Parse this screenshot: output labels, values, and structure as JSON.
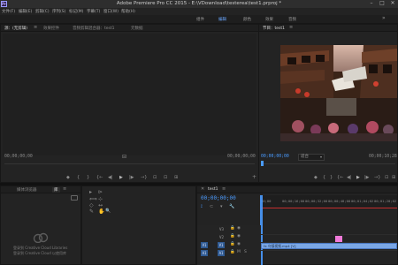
{
  "window": {
    "app_icon": "Pr",
    "title": "Adobe Premiere Pro CC 2015 - E:\\VDownload\\testerea\\test1.prproj *",
    "minimize": "–",
    "maximize": "□",
    "close": "✕"
  },
  "menu": [
    "文件(F)",
    "编辑(E)",
    "剪辑(C)",
    "序列(S)",
    "标记(M)",
    "字幕(T)",
    "窗口(W)",
    "帮助(H)"
  ],
  "workspaces": [
    "组件",
    "编辑",
    "颜色",
    "效果",
    "音频"
  ],
  "workspaces_more": "»",
  "source_panel": {
    "tabs": [
      "源：(无剪辑)",
      "效果控件",
      "音频剪辑混合器：test1",
      "元数据"
    ],
    "menu_icon": "≡",
    "timecode_left": "00;00;00;00",
    "timecode_right": "00;00;00;00",
    "controls": [
      "◆",
      "{",
      "}",
      "{←",
      "◀|",
      "▶",
      "|▶",
      "→}",
      "⊡",
      "⊡",
      "⊞"
    ],
    "add": "+"
  },
  "program_panel": {
    "tab": "节目：test1",
    "menu_icon": "≡",
    "timecode_left": "00;00;00;00",
    "fit": "适合",
    "timecode_right": "00;00;10;28",
    "controls": [
      "◆",
      "{",
      "}",
      "{←",
      "◀|",
      "▶",
      "|▶",
      "→}",
      "⊡",
      "⊞"
    ],
    "add": "+"
  },
  "project_panel": {
    "tabs": [
      "媒体浏览器",
      "库"
    ],
    "menu_icon": "≡",
    "cc_message_line1": "登录到 Creative Cloud Libraries",
    "cc_message_line2": "登录到 Creative Cloud 以使用库"
  },
  "tools": [
    "▸",
    "⊳",
    "⟺",
    "⊹",
    "◇",
    "↔",
    "✎",
    "✋",
    "🔍"
  ],
  "timeline": {
    "tab": "test1",
    "close": "✕",
    "menu_icon": "≡",
    "timecode": "00;00;00;00",
    "ruler": [
      "00;00",
      "00;00;16;00",
      "00;00;32;00",
      "00;00;48;00",
      "00;01;04;02",
      "00;01;20;02"
    ],
    "tracks": [
      {
        "src": "",
        "name": "V3"
      },
      {
        "src": "",
        "name": "V2"
      },
      {
        "src": "V1",
        "name": "V1"
      },
      {
        "src": "A1",
        "name": "A1"
      }
    ],
    "clip_label": "fx 乌镇视频.mp4 [V]"
  },
  "colors": {
    "accent_blue": "#4a9bff",
    "clip_blue": "#7aa7e6",
    "clip_pink": "#f07ad9",
    "playhead": "#4a9bff"
  }
}
